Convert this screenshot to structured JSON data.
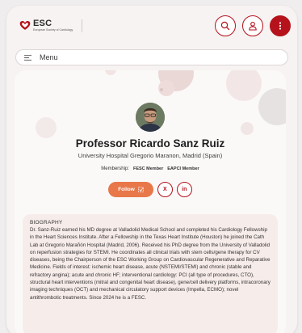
{
  "header": {
    "logo_text": "ESC",
    "logo_subtitle": "European Society of Cardiology",
    "icons": [
      "search-icon",
      "user-icon",
      "more-vertical-icon"
    ],
    "accent_color": "#b5121b"
  },
  "menu": {
    "label": "Menu",
    "icon": "hamburger-icon"
  },
  "profile": {
    "name": "Professor Ricardo Sanz Ruiz",
    "affiliation": "University Hospital Gregorio Maranon, Madrid (Spain)",
    "membership_label": "Membership:",
    "memberships": [
      "FESC Member",
      "EAPCI Member"
    ],
    "follow_label": "Follow",
    "social": [
      {
        "name": "x",
        "glyph": "X"
      },
      {
        "name": "linkedin",
        "glyph": "in"
      }
    ]
  },
  "biography": {
    "heading": "BIOGRAPHY",
    "text": "Dr. Sanz-Ruiz earned his MD degree at Valladolid Medical School and completed his Cardiology Fellowship in the Heart Sciences Institute. After a Fellowship in the Texas Heart Institute (Houston) he joined the Cath Lab at Gregorio Marañón Hospital (Madrid, 2006). Received his PhD degree from the University of Valladolid on reperfusion strategies for STEMI. He coordinates all clinical trials with stem cells/gene therapy for CV diseases, being the Chairperson of the ESC Working Group on Cardiovascular Regenerative and Reparative Medicine. Fields of interest: ischemic heart disease, acute (NSTEMI/STEMI) and chronic (stable and refractory angina); acute and chronic HF; interventional cardiology: PCI (all type of procedures, CTO), structural heart interventions (mitral and congenital heart disease), gene/cell delivery platforms, intracoronary imaging techniques (OCT) and mechanical circulatory support devices (Impella, ECMO); novel antithrombotic treatments. Since 2024 he is a FESC."
  }
}
